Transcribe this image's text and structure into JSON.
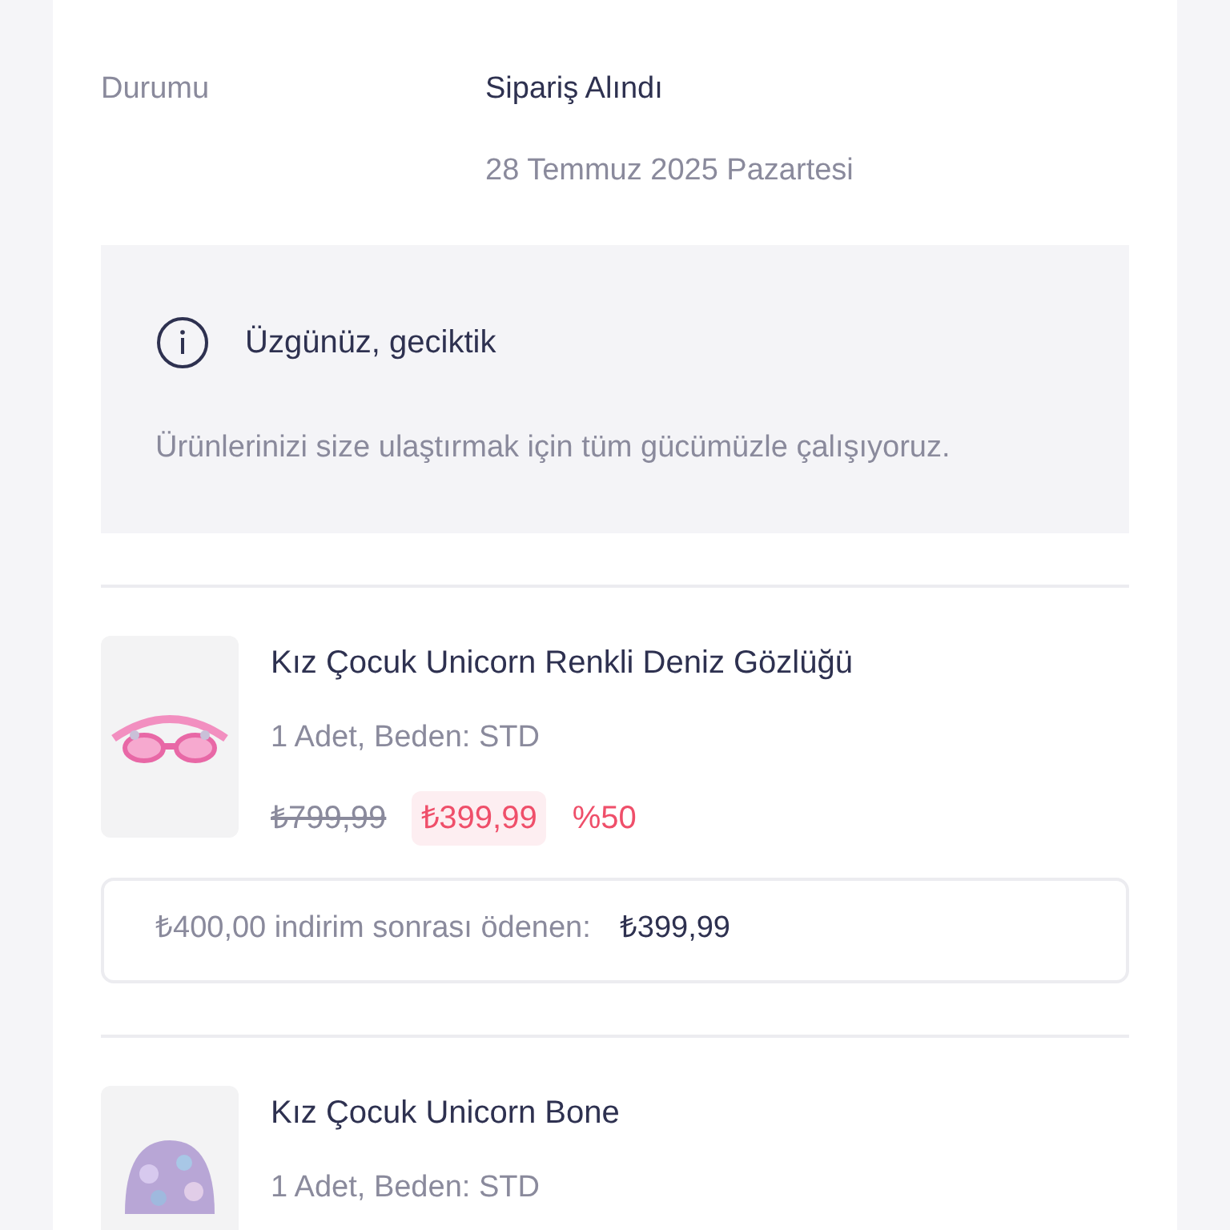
{
  "status": {
    "label": "Durumu",
    "value": "Sipariş Alındı",
    "date": "28 Temmuz 2025 Pazartesi"
  },
  "notice": {
    "title": "Üzgünüz, geciktik",
    "message": "Ürünlerinizi size ulaştırmak için tüm gücümüzle çalışıyoruz."
  },
  "products": [
    {
      "kind": "picture",
      "name": "Kız Çocuk Unicorn Renkli Deniz Gözlüğü",
      "details": "1 Adet, Beden: STD",
      "old_price": "₺799,99",
      "price": "₺399,99",
      "discount": "%50",
      "summary": {
        "label": "₺400,00 indirim sonrası ödenen:",
        "amount": "₺399,99"
      }
    },
    {
      "kind": "picture",
      "name": "Kız Çocuk Unicorn Bone",
      "details": "1 Adet, Beden: STD"
    }
  ]
}
